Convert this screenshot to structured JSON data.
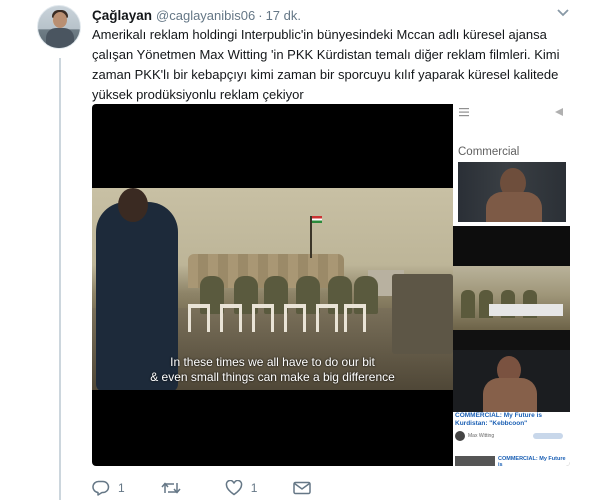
{
  "tweet": {
    "display_name": "Çağlayan",
    "handle": "@caglayanibis06",
    "separator": "·",
    "time": "17 dk.",
    "text": "Amerikalı reklam holdingi Interpublic'in bünyesindeki Mccan adlı küresel ajansa çalışan Yönetmen Max Witting 'in PKK Kürdistan temalı diğer reklam filmleri. Kimi zaman PKK'lı bir kebapçıyı kimi zaman bir sporcuyu kılıf yaparak küresel kalitede yüksek prodüksiyonlu reklam çekiyor"
  },
  "media": {
    "subtitle_line1": "In these times we all have to do our bit",
    "subtitle_line2": "& even small things can make a big difference",
    "sidebar": {
      "section_label": "Commercial",
      "related_title": "COMMERCIAL: My Future is Kurdistan: \"Kebbcoon\"",
      "related_user": "Max Witting",
      "related_title_2": "COMMERCIAL: My Future is"
    }
  },
  "actions": {
    "reply": {
      "icon": "reply-icon",
      "count": "1"
    },
    "retweet": {
      "icon": "retweet-icon",
      "count": ""
    },
    "like": {
      "icon": "heart-icon",
      "count": "1"
    },
    "message": {
      "icon": "envelope-icon",
      "count": ""
    }
  },
  "colors": {
    "text": "#14171a",
    "secondary": "#657786",
    "thread_line": "#ccd6dd",
    "link_blue": "#1a5fb4"
  }
}
